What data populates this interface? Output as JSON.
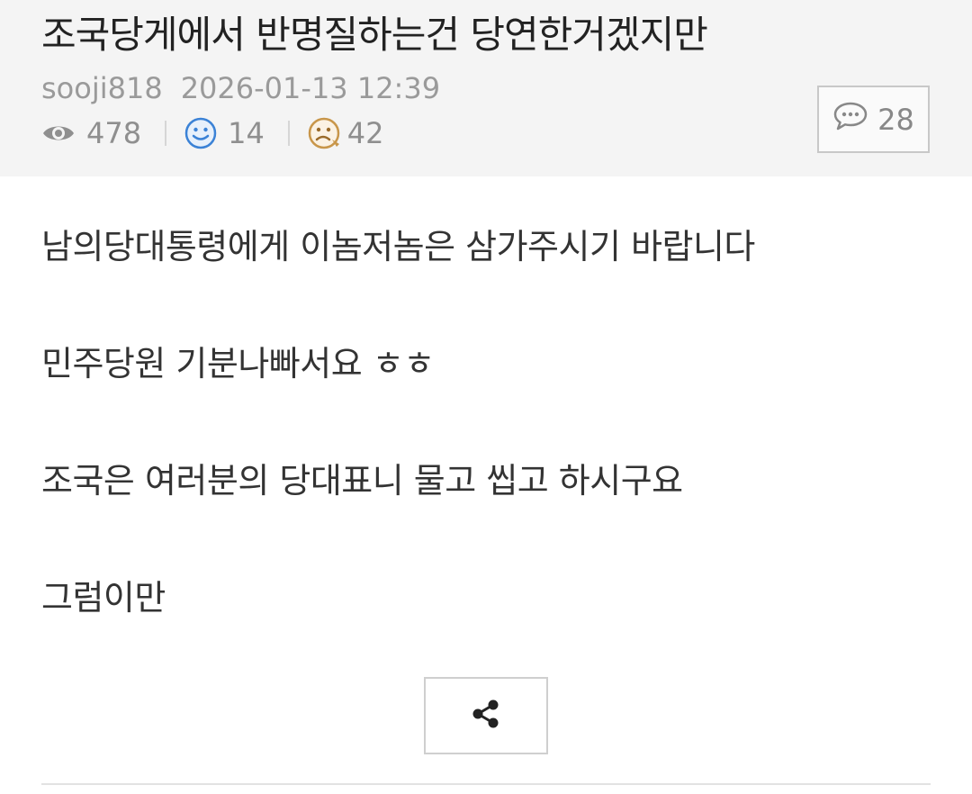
{
  "post": {
    "title": "조국당게에서 반명질하는건 당연한거겠지만",
    "author": "sooji818",
    "datetime": "2026-01-13 12:39",
    "views": "478",
    "likes": "14",
    "dislikes": "42",
    "comments": "28"
  },
  "content": {
    "paragraphs": [
      "남의당대통령에게 이놈저놈은 삼가주시기 바랍니다",
      "민주당원 기분나빠서요 ㅎㅎ",
      "조국은 여러분의 당대표니 물고 씹고 하시구요",
      "그럼이만"
    ]
  },
  "icons": {
    "views": "eye-icon",
    "likes": "smile-icon",
    "dislikes": "frown-icon",
    "comments": "speech-bubble-icon",
    "share": "share-icon"
  },
  "colors": {
    "header_bg": "#f4f4f4",
    "like_blue": "#3b82d6",
    "dislike_brown": "#c8964a"
  }
}
